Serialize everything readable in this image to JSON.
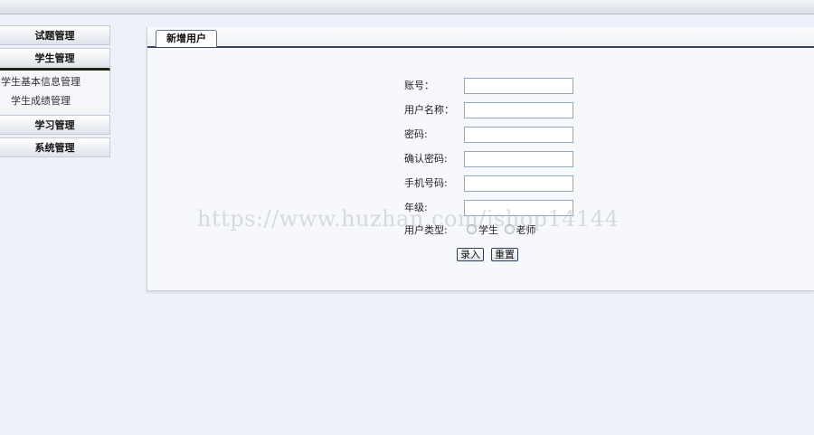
{
  "sidebar": {
    "menus": [
      {
        "label": "试题管理"
      },
      {
        "label": "学生管理",
        "items": [
          "学生基本信息管理",
          "学生成绩管理"
        ]
      },
      {
        "label": "学习管理"
      },
      {
        "label": "系统管理"
      }
    ]
  },
  "panel": {
    "tab_label": "新增用户"
  },
  "form": {
    "fields": [
      {
        "label": "账号：",
        "value": ""
      },
      {
        "label": "用户名称：",
        "value": ""
      },
      {
        "label": "密码:",
        "value": ""
      },
      {
        "label": "确认密码:",
        "value": ""
      },
      {
        "label": "手机号码:",
        "value": ""
      },
      {
        "label": "年级:",
        "value": ""
      }
    ],
    "user_type": {
      "label": "用户类型:",
      "options": [
        "学生",
        "老师"
      ]
    },
    "submit_label": "录入",
    "reset_label": "重置"
  },
  "watermark": "https://www.huzhan.com/ishop14144"
}
